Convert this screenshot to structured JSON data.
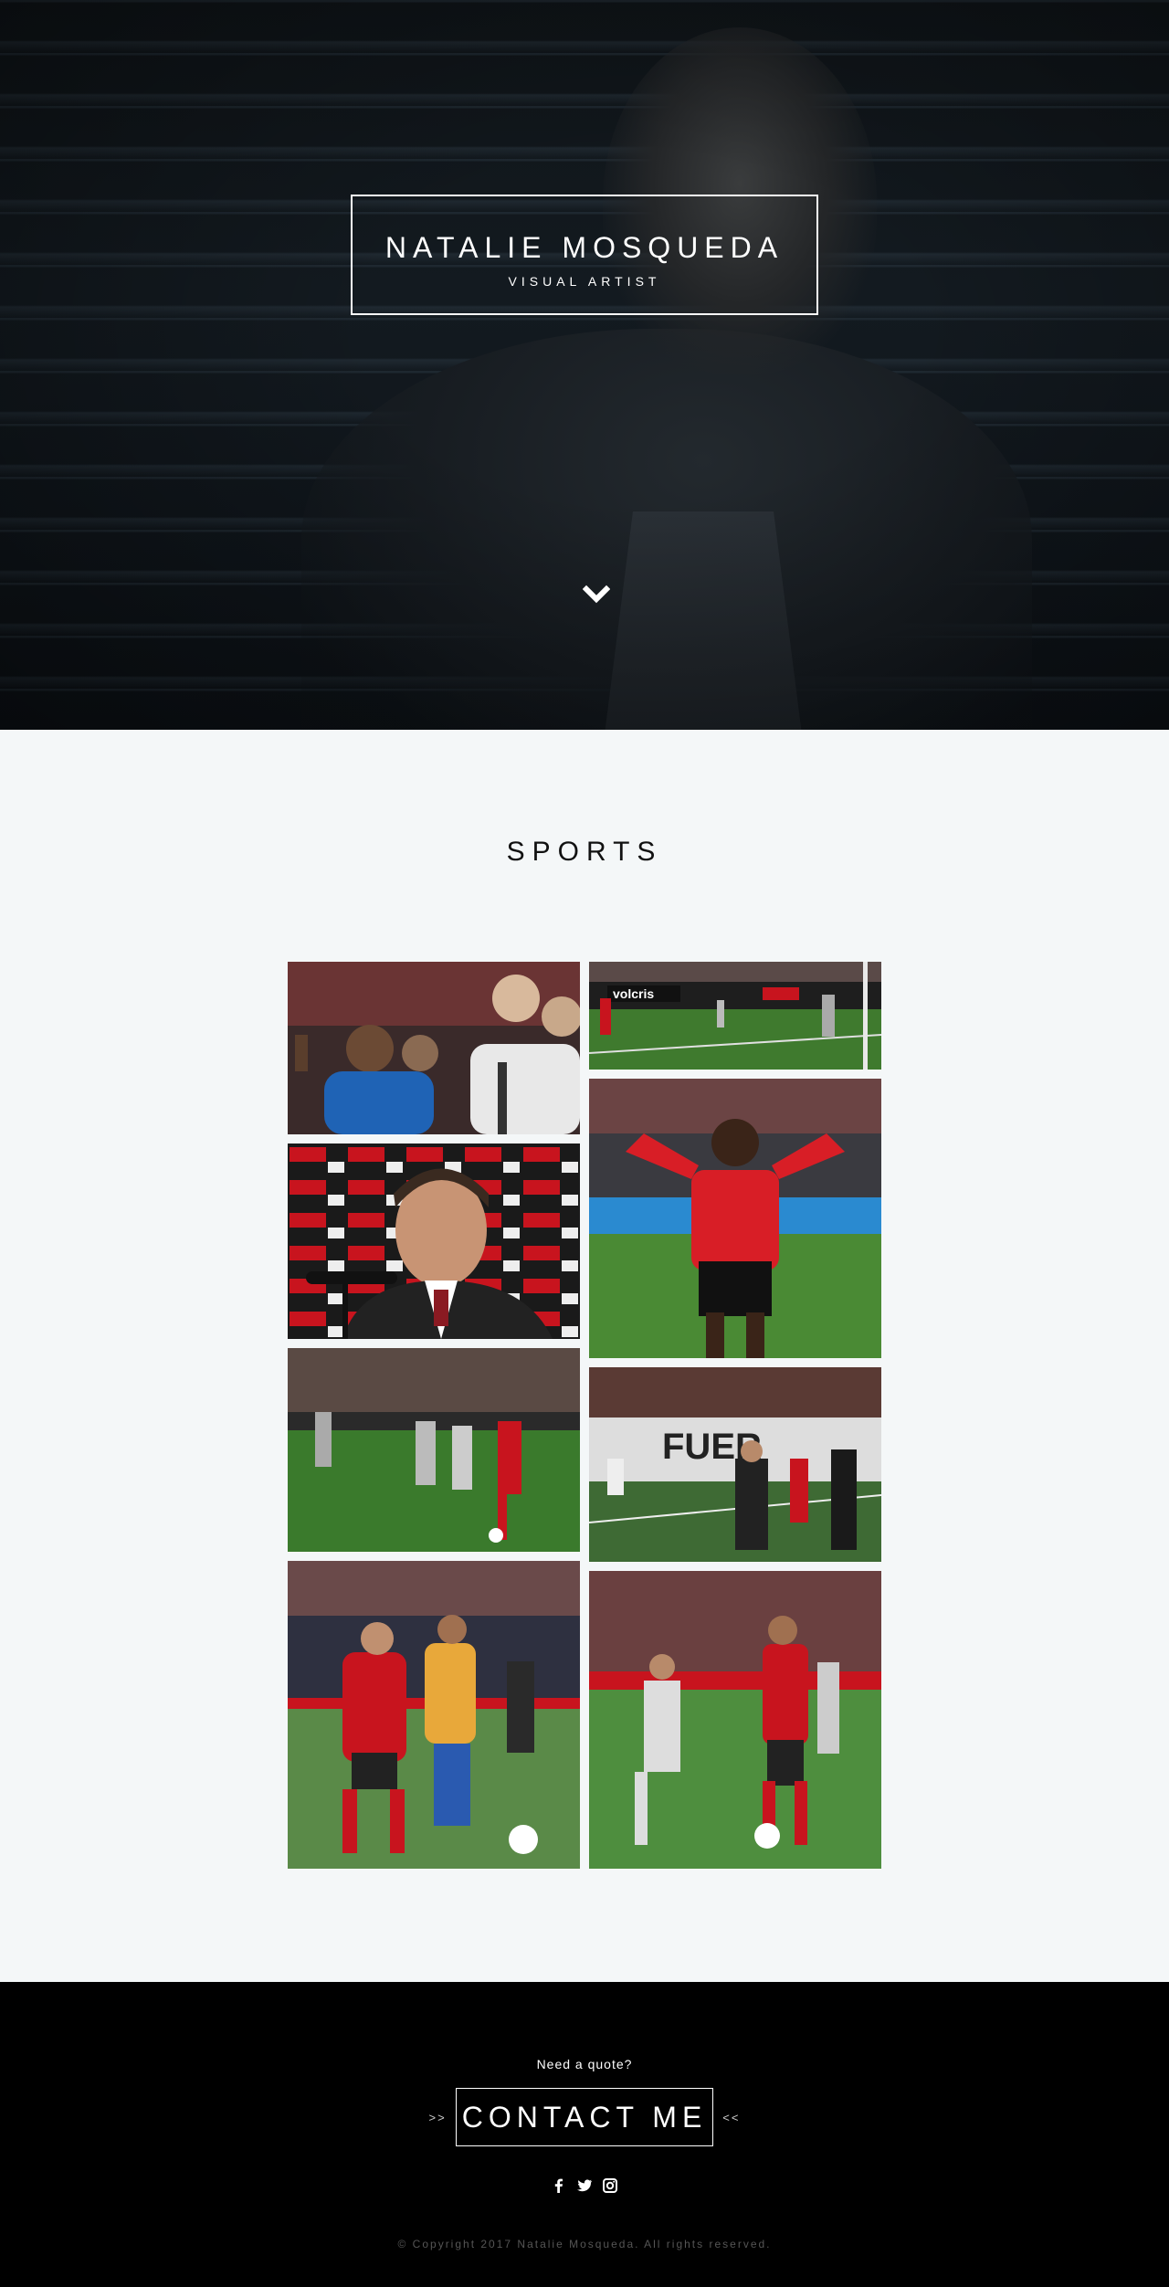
{
  "hero": {
    "name": "NATALIE MOSQUEDA",
    "role": "VISUAL ARTIST"
  },
  "section": {
    "title": "SPORTS"
  },
  "gallery": [
    {
      "subject": "referee and players arguing"
    },
    {
      "subject": "goal scored in stadium"
    },
    {
      "subject": "coach at press conference"
    },
    {
      "subject": "player celebrating with hands on head"
    },
    {
      "subject": "players contesting ball on pitch"
    },
    {
      "subject": "coach on touchline"
    },
    {
      "subject": "two players battling for ball"
    },
    {
      "subject": "player dribbling past defender"
    }
  ],
  "footer": {
    "quote": "Need a quote?",
    "arrows_left": ">>",
    "contact_label": "CONTACT ME",
    "arrows_right": "<<",
    "copyright": "© Copyright 2017 Natalie Mosqueda. All rights reserved."
  },
  "icons": [
    "facebook-icon",
    "twitter-icon",
    "instagram-icon",
    "chevron-down-icon"
  ],
  "colors": {
    "footer_bg": "#000000",
    "page_bg": "#f4f7f8",
    "accent_red": "#c8141e"
  }
}
